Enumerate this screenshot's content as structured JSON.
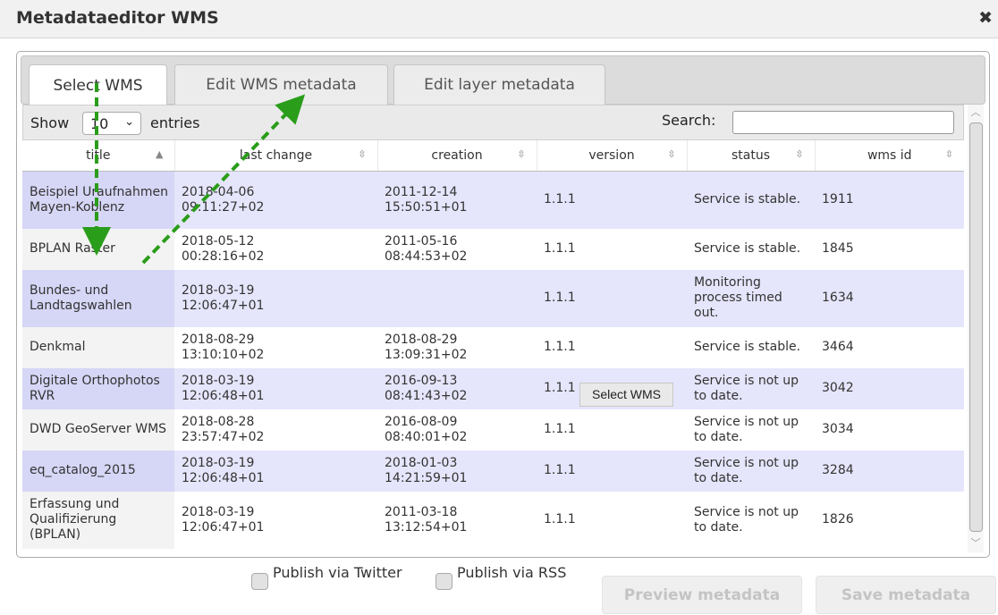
{
  "dialog": {
    "title": "Metadataeditor WMS",
    "close_icon": "✖"
  },
  "tabs": [
    {
      "label": "Select WMS",
      "active": true
    },
    {
      "label": "Edit WMS metadata",
      "active": false
    },
    {
      "label": "Edit layer metadata",
      "active": false
    }
  ],
  "controls": {
    "show_label": "Show",
    "entries_value": "10",
    "entries_label": "entries",
    "search_label": "Search:",
    "search_value": ""
  },
  "table": {
    "columns": [
      "title",
      "last change",
      "creation",
      "version",
      "status",
      "wms id"
    ],
    "rows": [
      [
        "Beispiel Uraufnahmen Mayen-Koblenz",
        "2018-04-06 09:11:27+02",
        "2011-12-14 15:50:51+01",
        "1.1.1",
        "Service is stable.",
        "1911"
      ],
      [
        "BPLAN Raster",
        "2018-05-12 00:28:16+02",
        "2011-05-16 08:44:53+02",
        "1.1.1",
        "Service is stable.",
        "1845"
      ],
      [
        "Bundes- und Landtagswahlen",
        "2018-03-19 12:06:47+01",
        "",
        "1.1.1",
        "Monitoring process timed out.",
        "1634"
      ],
      [
        "Denkmal",
        "2018-08-29 13:10:10+02",
        "2018-08-29 13:09:31+02",
        "1.1.1",
        "Service is stable.",
        "3464"
      ],
      [
        "Digitale Orthophotos RVR",
        "2018-03-19 12:06:48+01",
        "2016-09-13 08:41:43+02",
        "1.1.1",
        "Service is not up to date.",
        "3042"
      ],
      [
        "DWD GeoServer WMS",
        "2018-08-28 23:57:47+02",
        "2016-08-09 08:40:01+02",
        "1.1.1",
        "Service is not up to date.",
        "3034"
      ],
      [
        "eq_catalog_2015",
        "2018-03-19 12:06:48+01",
        "2018-01-03 14:21:59+01",
        "1.1.1",
        "Service is not up to date.",
        "3284"
      ],
      [
        "Erfassung und Qualifizierung (BPLAN)",
        "2018-03-19 12:06:47+01",
        "2011-03-18 13:12:54+01",
        "1.1.1",
        "Service is not up to date.",
        "1826"
      ]
    ]
  },
  "tooltip": "Select WMS",
  "footer": {
    "publish_twitter": "Publish via Twitter",
    "publish_rss": "Publish via RSS",
    "preview_button": "Preview metadata",
    "save_button": "Save metadata"
  },
  "colors": {
    "annotation_arrow": "#2a9d1a",
    "row_highlight": "#e5e5fb"
  }
}
